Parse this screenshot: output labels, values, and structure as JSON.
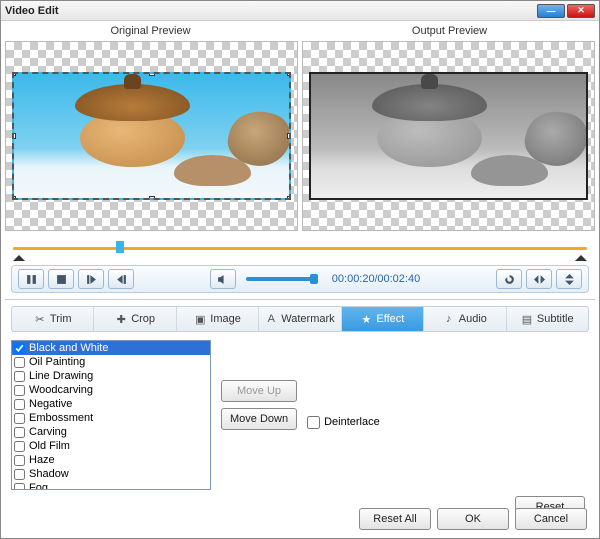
{
  "window": {
    "title": "Video Edit"
  },
  "preview": {
    "original_label": "Original Preview",
    "output_label": "Output Preview"
  },
  "playback": {
    "time_current": "00:00:20",
    "time_total": "00:02:40"
  },
  "tabs": {
    "trim": "Trim",
    "crop": "Crop",
    "image": "Image",
    "watermark": "Watermark",
    "effect": "Effect",
    "audio": "Audio",
    "subtitle": "Subtitle",
    "active": "effect"
  },
  "effects": {
    "items": [
      "Black and White",
      "Oil Painting",
      "Line Drawing",
      "Woodcarving",
      "Negative",
      "Embossment",
      "Carving",
      "Old Film",
      "Haze",
      "Shadow",
      "Fog"
    ],
    "selected": 0,
    "checked": [
      0
    ]
  },
  "buttons": {
    "move_up": "Move Up",
    "move_down": "Move Down",
    "deinterlace": "Deinterlace",
    "reset": "Reset",
    "reset_all": "Reset All",
    "ok": "OK",
    "cancel": "Cancel"
  }
}
